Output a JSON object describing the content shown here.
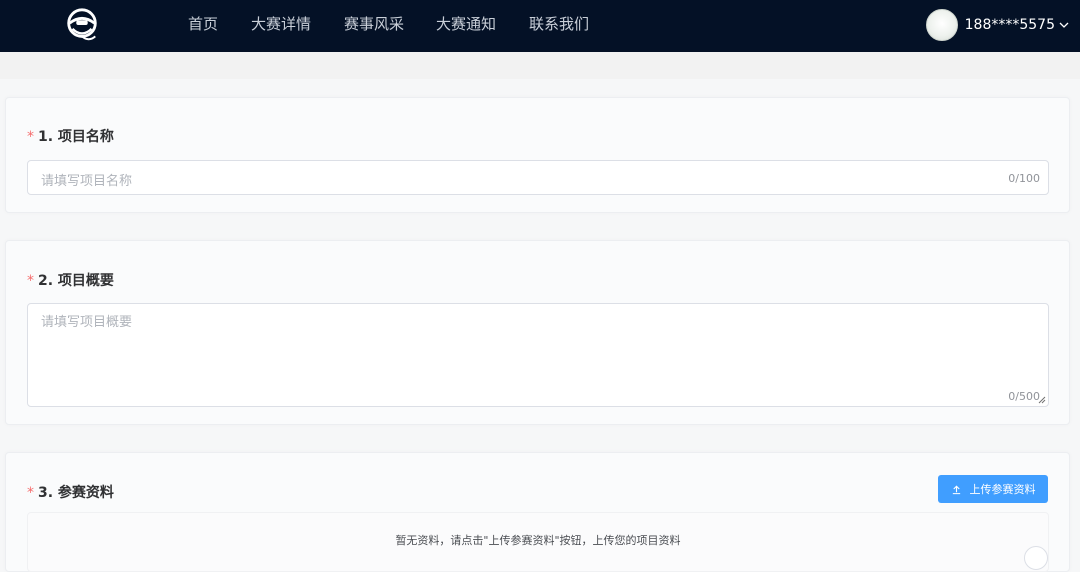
{
  "nav": {
    "items": [
      {
        "label": "首页"
      },
      {
        "label": "大赛详情"
      },
      {
        "label": "赛事风采"
      },
      {
        "label": "大赛通知"
      },
      {
        "label": "联系我们"
      }
    ],
    "user": {
      "name": "188****5575"
    }
  },
  "form": {
    "project_name": {
      "required_mark": "*",
      "title": "1. 项目名称",
      "placeholder": "请填写项目名称",
      "counter": "0/100"
    },
    "project_summary": {
      "required_mark": "*",
      "title": "2. 项目概要",
      "placeholder": "请填写项目概要",
      "counter": "0/500"
    },
    "materials": {
      "required_mark": "*",
      "title": "3. 参赛资料",
      "upload_label": "上传参赛资料",
      "empty_text": "暂无资料，请点击\"上传参赛资料\"按钮，上传您的项目资料"
    }
  },
  "colors": {
    "navbar": "#041126",
    "primary": "#409eff",
    "required": "#f56c6c"
  }
}
